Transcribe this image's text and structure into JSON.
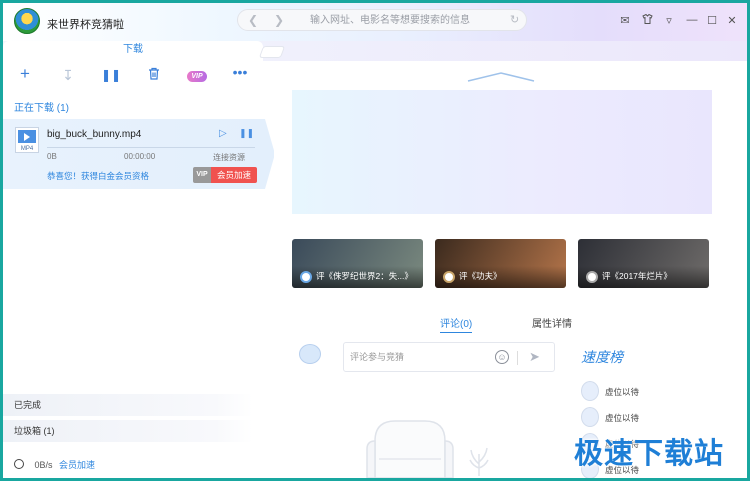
{
  "app": {
    "title": "来世界杯竞猜啦"
  },
  "address_bar": {
    "placeholder": "输入网址、电影名等想要搜索的信息"
  },
  "tabs": {
    "active_label": "下载"
  },
  "toolbar": {
    "add_icon": "plus-icon",
    "download_icon": "download-icon",
    "pause_icon": "pause-icon",
    "delete_icon": "trash-icon",
    "vip_label": "VIP",
    "more_icon": "more-icon"
  },
  "downloading": {
    "header": "正在下载 (1)",
    "item": {
      "icon_ext": "MP4",
      "filename": "big_buck_bunny.mp4",
      "size": "0B",
      "time": "00:00:00",
      "status": "连接资源",
      "promo": "恭喜您！获得白金会员资格",
      "vip_tag": "VIP",
      "accelerate_label": "会员加速"
    }
  },
  "bottom": {
    "completed": "已完成",
    "trash": "垃圾箱 (1)",
    "speed": "0B/s",
    "accelerate_link": "会员加速"
  },
  "movies": [
    {
      "title": "评《侏罗纪世界2：失...》",
      "colors": [
        "#3a4a5a",
        "#7b8a7f"
      ]
    },
    {
      "title": "评《功夫》",
      "colors": [
        "#3b2a1e",
        "#b5754a"
      ]
    },
    {
      "title": "评《2017年烂片》",
      "colors": [
        "#2d2f36",
        "#6f6c6a"
      ]
    }
  ],
  "detail_tabs": {
    "comments": "评论(0)",
    "attributes": "属性详情"
  },
  "comment": {
    "placeholder": "评论参与竞猜"
  },
  "ranking": {
    "title": "速度榜",
    "items": [
      "虚位以待",
      "虚位以待",
      "虚位以待",
      "虚位以待"
    ]
  },
  "watermark": {
    "text": "极速下载站"
  },
  "colors": {
    "accent": "#2e86de",
    "vip_red": "#f0524f",
    "frame": "#19a7a0"
  }
}
